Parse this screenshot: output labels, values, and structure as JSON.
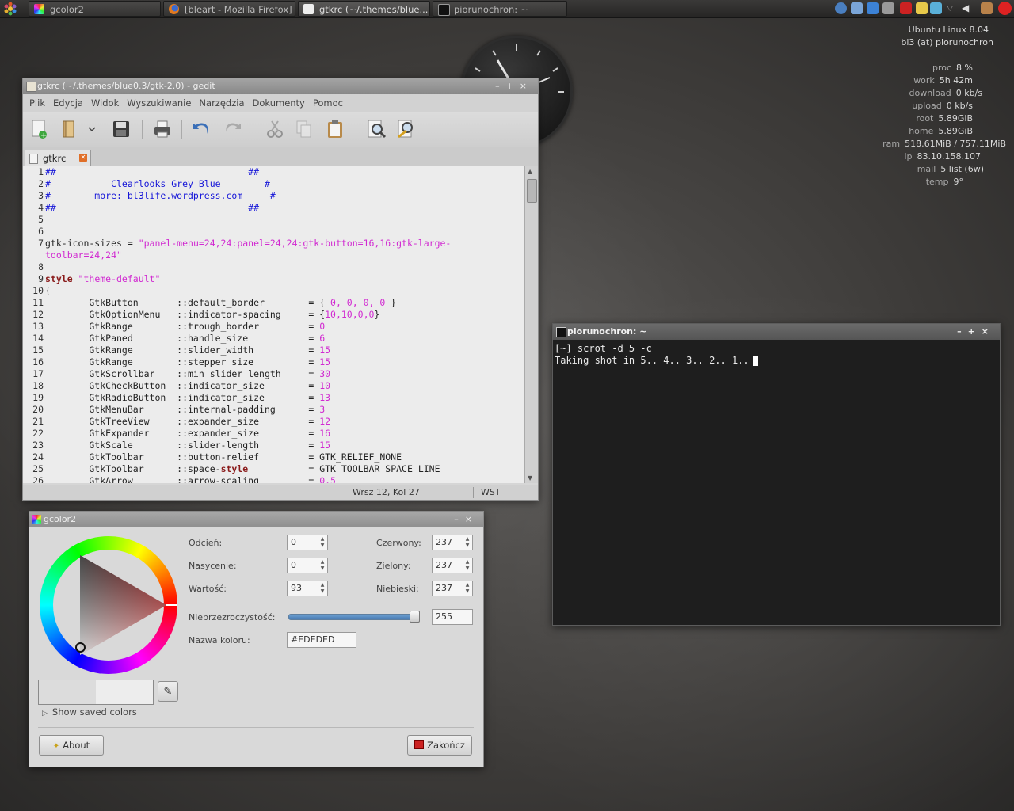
{
  "taskbar": {
    "tasks": [
      {
        "label": "gcolor2"
      },
      {
        "label": "[bleart - Mozilla Firefox]"
      },
      {
        "label": "gtkrc (~/.themes/blue..."
      },
      {
        "label": "piorunochron: ~"
      }
    ],
    "tray_icons": [
      "gear-icon",
      "network-icon",
      "mail-icon",
      "mail-icon",
      "download-icon",
      "notes-icon",
      "dropbox-icon",
      "wifi-icon",
      "volume-icon",
      "folder-icon",
      "power-icon"
    ]
  },
  "conky": {
    "header": "Ubuntu Linux 8.04",
    "user": "bl3 (at) piorunochron",
    "rows": [
      {
        "label": "proc",
        "value": "8  %"
      },
      {
        "label": "work",
        "value": "5h 42m"
      },
      {
        "label": "download",
        "value": "0  kb/s"
      },
      {
        "label": "upload",
        "value": "0  kb/s"
      },
      {
        "label": "root",
        "value": "5.89GiB"
      },
      {
        "label": "home",
        "value": "5.89GiB"
      },
      {
        "label": "ram",
        "value": "518.61MiB / 757.11MiB"
      },
      {
        "label": "ip",
        "value": "83.10.158.107"
      },
      {
        "label": "mail",
        "value": "5 list (6w)"
      },
      {
        "label": "temp",
        "value": "9°"
      }
    ]
  },
  "gedit": {
    "title": "gtkrc (~/.themes/blue0.3/gtk-2.0) - gedit",
    "menu": [
      "Plik",
      "Edycja",
      "Widok",
      "Wyszukiwanie",
      "Narzędzia",
      "Dokumenty",
      "Pomoc"
    ],
    "tab_label": "gtkrc",
    "status": {
      "position": "Wrsz 12, Kol 27",
      "mode": "WST"
    },
    "lines": [
      {
        "n": "1",
        "parts": [
          {
            "t": "##                                   ##",
            "c": "cm"
          }
        ]
      },
      {
        "n": "2",
        "parts": [
          {
            "t": "#           Clearlooks Grey Blue        #",
            "c": "cm"
          }
        ]
      },
      {
        "n": "3",
        "parts": [
          {
            "t": "#        more: bl3life.wordpress.com     #",
            "c": "cm"
          }
        ]
      },
      {
        "n": "4",
        "parts": [
          {
            "t": "##                                   ##",
            "c": "cm"
          }
        ]
      },
      {
        "n": "5",
        "parts": []
      },
      {
        "n": "6",
        "parts": []
      },
      {
        "n": "7",
        "parts": [
          {
            "t": "gtk-icon-sizes = ",
            "c": ""
          },
          {
            "t": "\"panel-menu=24,24:panel=24,24:gtk-button=16,16:gtk-large-",
            "c": "str"
          }
        ]
      },
      {
        "n": "",
        "parts": [
          {
            "t": "toolbar=24,24\"",
            "c": "str"
          }
        ]
      },
      {
        "n": "8",
        "parts": []
      },
      {
        "n": "9",
        "parts": [
          {
            "t": "style",
            "c": "kw"
          },
          {
            "t": " \"theme-default\"",
            "c": "str"
          }
        ]
      },
      {
        "n": "10",
        "parts": [
          {
            "t": "{",
            "c": ""
          }
        ]
      },
      {
        "n": "11",
        "parts": [
          {
            "t": "        GtkButton       ::default_border        = { ",
            "c": ""
          },
          {
            "t": "0, 0, 0, 0",
            "c": "num"
          },
          {
            "t": " }",
            "c": ""
          }
        ]
      },
      {
        "n": "12",
        "parts": [
          {
            "t": "        GtkOptionMenu   ::indicator-spacing     = {",
            "c": ""
          },
          {
            "t": "10,10,0,0",
            "c": "num"
          },
          {
            "t": "}",
            "c": ""
          }
        ]
      },
      {
        "n": "13",
        "parts": [
          {
            "t": "        GtkRange        ::trough_border         = ",
            "c": ""
          },
          {
            "t": "0",
            "c": "num"
          }
        ]
      },
      {
        "n": "14",
        "parts": [
          {
            "t": "        GtkPaned        ::handle_size           = ",
            "c": ""
          },
          {
            "t": "6",
            "c": "num"
          }
        ]
      },
      {
        "n": "15",
        "parts": [
          {
            "t": "        GtkRange        ::slider_width          = ",
            "c": ""
          },
          {
            "t": "15",
            "c": "num"
          }
        ]
      },
      {
        "n": "16",
        "parts": [
          {
            "t": "        GtkRange        ::stepper_size          = ",
            "c": ""
          },
          {
            "t": "15",
            "c": "num"
          }
        ]
      },
      {
        "n": "17",
        "parts": [
          {
            "t": "        GtkScrollbar    ::min_slider_length     = ",
            "c": ""
          },
          {
            "t": "30",
            "c": "num"
          }
        ]
      },
      {
        "n": "18",
        "parts": [
          {
            "t": "        GtkCheckButton  ::indicator_size        = ",
            "c": ""
          },
          {
            "t": "10",
            "c": "num"
          }
        ]
      },
      {
        "n": "19",
        "parts": [
          {
            "t": "        GtkRadioButton  ::indicator_size        = ",
            "c": ""
          },
          {
            "t": "13",
            "c": "num"
          }
        ]
      },
      {
        "n": "20",
        "parts": [
          {
            "t": "        GtkMenuBar      ::internal-padding      = ",
            "c": ""
          },
          {
            "t": "3",
            "c": "num"
          }
        ]
      },
      {
        "n": "21",
        "parts": [
          {
            "t": "        GtkTreeView     ::expander_size         = ",
            "c": ""
          },
          {
            "t": "12",
            "c": "num"
          }
        ]
      },
      {
        "n": "22",
        "parts": [
          {
            "t": "        GtkExpander     ::expander_size         = ",
            "c": ""
          },
          {
            "t": "16",
            "c": "num"
          }
        ]
      },
      {
        "n": "23",
        "parts": [
          {
            "t": "        GtkScale        ::slider-length         = ",
            "c": ""
          },
          {
            "t": "15",
            "c": "num"
          }
        ]
      },
      {
        "n": "24",
        "parts": [
          {
            "t": "        GtkToolbar      ::button-relief         = GTK_RELIEF_NONE",
            "c": ""
          }
        ]
      },
      {
        "n": "25",
        "parts": [
          {
            "t": "        GtkToolbar      ::space-",
            "c": ""
          },
          {
            "t": "style",
            "c": "kw"
          },
          {
            "t": "           = GTK_TOOLBAR_SPACE_LINE",
            "c": ""
          }
        ]
      },
      {
        "n": "26",
        "parts": [
          {
            "t": "        GtkArrow        ::arrow-scaling         = ",
            "c": ""
          },
          {
            "t": "0.5",
            "c": "num"
          }
        ]
      }
    ]
  },
  "terminal": {
    "title": "piorunochron: ~",
    "lines": [
      "[~] scrot -d 5 -c",
      "Taking shot in 5.. 4.. 3.. 2.. 1.."
    ]
  },
  "gcolor": {
    "title": "gcolor2",
    "hue_label": "Odcień:",
    "hue_value": "0",
    "sat_label": "Nasycenie:",
    "sat_value": "0",
    "val_label": "Wartość:",
    "val_value": "93",
    "red_label": "Czerwony:",
    "red_value": "237",
    "green_label": "Zielony:",
    "green_value": "237",
    "blue_label": "Niebieski:",
    "blue_value": "237",
    "opacity_label": "Nieprzezroczystość:",
    "opacity_value": "255",
    "name_label": "Nazwa koloru:",
    "name_value": "#EDEDED",
    "show_saved": "Show saved colors",
    "about": "About",
    "quit": "Zakończ",
    "current_color": "#ededed"
  }
}
